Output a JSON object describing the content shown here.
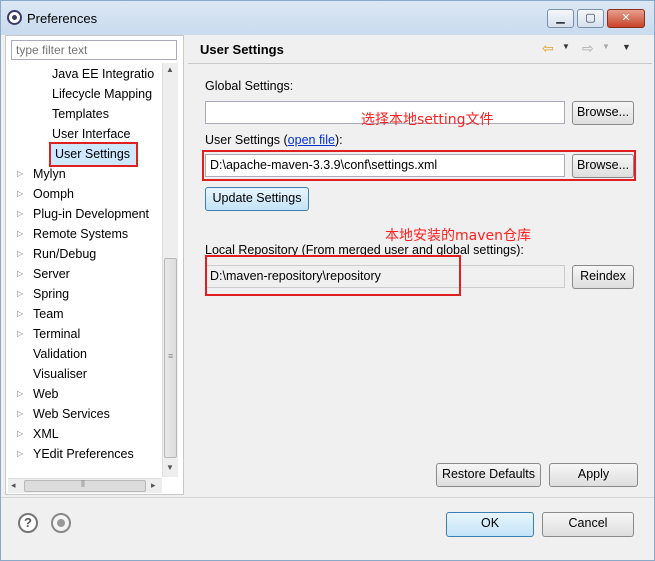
{
  "window": {
    "title": "Preferences"
  },
  "window_controls": {
    "minimize": "▁",
    "maximize": "▢",
    "close": "✕"
  },
  "filter": {
    "placeholder": "type filter text"
  },
  "tree": {
    "items": [
      {
        "label": "Java EE Integratio",
        "expandable": false,
        "selected": false
      },
      {
        "label": "Lifecycle Mapping",
        "expandable": false,
        "selected": false
      },
      {
        "label": "Templates",
        "expandable": false,
        "selected": false
      },
      {
        "label": "User Interface",
        "expandable": false,
        "selected": false
      },
      {
        "label": "User Settings",
        "expandable": false,
        "selected": true
      },
      {
        "label": "Mylyn",
        "expandable": true,
        "selected": false
      },
      {
        "label": "Oomph",
        "expandable": true,
        "selected": false
      },
      {
        "label": "Plug-in Development",
        "expandable": true,
        "selected": false
      },
      {
        "label": "Remote Systems",
        "expandable": true,
        "selected": false
      },
      {
        "label": "Run/Debug",
        "expandable": true,
        "selected": false
      },
      {
        "label": "Server",
        "expandable": true,
        "selected": false
      },
      {
        "label": "Spring",
        "expandable": true,
        "selected": false
      },
      {
        "label": "Team",
        "expandable": true,
        "selected": false
      },
      {
        "label": "Terminal",
        "expandable": true,
        "selected": false
      },
      {
        "label": "Validation",
        "expandable": false,
        "selected": false
      },
      {
        "label": "Visualiser",
        "expandable": false,
        "selected": false
      },
      {
        "label": "Web",
        "expandable": true,
        "selected": false
      },
      {
        "label": "Web Services",
        "expandable": true,
        "selected": false
      },
      {
        "label": "XML",
        "expandable": true,
        "selected": false
      },
      {
        "label": "YEdit Preferences",
        "expandable": true,
        "selected": false
      }
    ]
  },
  "page": {
    "title": "User Settings",
    "global_settings_label": "Global Settings:",
    "global_settings_value": "",
    "browse_label": "Browse...",
    "user_settings_label_prefix": "User Settings (",
    "user_settings_link": "open file",
    "user_settings_label_suffix": "):",
    "user_settings_value": "D:\\apache-maven-3.3.9\\conf\\settings.xml",
    "update_settings_label": "Update Settings",
    "local_repo_label": "Local Repository (From merged user and global settings):",
    "local_repo_value": "D:\\maven-repository\\repository",
    "reindex_label": "Reindex",
    "restore_defaults_label": "Restore Defaults",
    "apply_label": "Apply"
  },
  "annotations": {
    "choose_setting": "选择本地setting文件",
    "local_repo": "本地安装的maven仓库"
  },
  "footer": {
    "help_glyph": "?",
    "ok_label": "OK",
    "cancel_label": "Cancel"
  },
  "colors": {
    "annotation_red": "#e02020",
    "selection_blue": "#cde8ff",
    "link_blue": "#0033cc"
  }
}
